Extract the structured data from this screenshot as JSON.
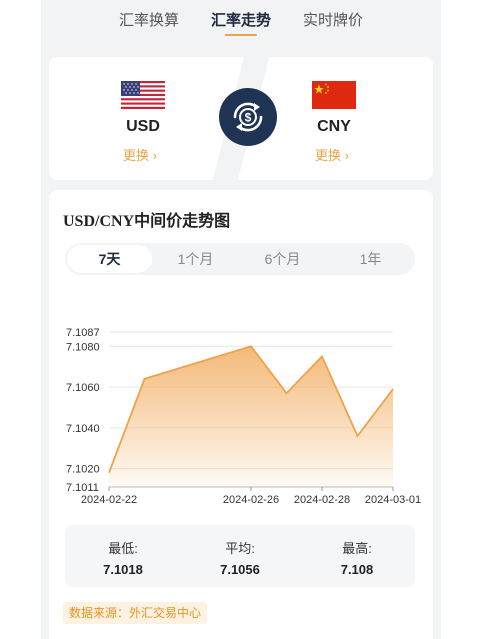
{
  "tabs": [
    {
      "label": "汇率换算"
    },
    {
      "label": "汇率走势"
    },
    {
      "label": "实时牌价"
    }
  ],
  "from_currency": {
    "code": "USD",
    "change_label": "更换"
  },
  "to_currency": {
    "code": "CNY",
    "change_label": "更换"
  },
  "chart": {
    "title": "USD/CNY中间价走势图",
    "periods": [
      "7天",
      "1个月",
      "6个月",
      "1年"
    ],
    "selected_period": "7天"
  },
  "chart_data": {
    "type": "area",
    "x": [
      "2024-02-22",
      "2024-02-23",
      "2024-02-26",
      "2024-02-27",
      "2024-02-28",
      "2024-02-29",
      "2024-03-01"
    ],
    "y": [
      7.1018,
      7.1064,
      7.108,
      7.1057,
      7.1075,
      7.1036,
      7.1059
    ],
    "x_tick_labels": [
      "2024-02-22",
      "2024-02-26",
      "2024-02-28",
      "2024-03-01"
    ],
    "y_tick_labels": [
      "7.1087",
      "7.1080",
      "7.1060",
      "7.1040",
      "7.1020",
      "7.1011"
    ],
    "ylim": [
      7.1011,
      7.1087
    ],
    "grid": true,
    "color": "#f0a24a"
  },
  "stats": [
    {
      "label": "最低:",
      "value": "7.1018"
    },
    {
      "label": "平均:",
      "value": "7.1056"
    },
    {
      "label": "最高:",
      "value": "7.108"
    }
  ],
  "source": "数据来源：外汇交易中心",
  "colors": {
    "accent": "#f0a24a",
    "navy": "#1f3354"
  }
}
